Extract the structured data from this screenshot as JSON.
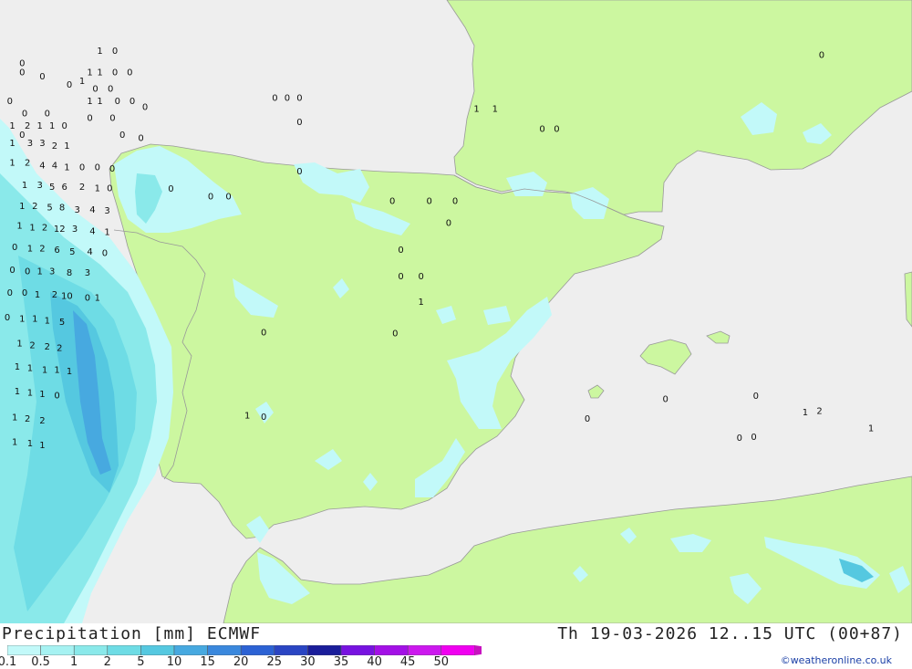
{
  "title": "Precipitation [mm] ECMWF",
  "datetime": "Th 19-03-2026 12..15 UTC (00+87)",
  "credit": "©weatheronline.co.uk",
  "colors": {
    "sea": "#eeeeee",
    "land": "#ccf7a0",
    "border": "#999999",
    "label": "#111111",
    "credit": "#1a3fa6"
  },
  "legend": {
    "ticks": [
      "0.1",
      "0.5",
      "1",
      "2",
      "5",
      "10",
      "15",
      "20",
      "25",
      "30",
      "35",
      "40",
      "45",
      "50"
    ],
    "colors": [
      "#c2f9f9",
      "#a6f2f2",
      "#8ae9ea",
      "#6edce5",
      "#55c8e0",
      "#47a9e0",
      "#3a88dd",
      "#2c62d4",
      "#2a45c3",
      "#1a1d9a",
      "#7712e0",
      "#a310e6",
      "#cc18ee",
      "#f000f0",
      "#c812c0"
    ]
  },
  "map_labels": [
    {
      "text": "0",
      "lon": -9.66,
      "lat": 43.82
    },
    {
      "text": "0",
      "lon": -9.17,
      "lat": 43.62
    },
    {
      "text": "0",
      "lon": -8.51,
      "lat": 43.49
    },
    {
      "text": "0",
      "lon": -7.88,
      "lat": 43.43
    },
    {
      "text": "0",
      "lon": -7.51,
      "lat": 43.43
    },
    {
      "text": "0",
      "lon": -6.67,
      "lat": 43.15
    },
    {
      "text": "0",
      "lon": -3.51,
      "lat": 43.29
    },
    {
      "text": "0",
      "lon": -3.21,
      "lat": 43.29
    },
    {
      "text": "0",
      "lon": -2.91,
      "lat": 43.29
    },
    {
      "text": "0",
      "lon": -2.91,
      "lat": 42.92
    },
    {
      "text": "0",
      "lon": -2.91,
      "lat": 42.16
    },
    {
      "text": "0",
      "lon": -6.77,
      "lat": 42.67
    },
    {
      "text": "0",
      "lon": -6.04,
      "lat": 41.89
    },
    {
      "text": "0",
      "lon": -5.07,
      "lat": 41.77
    },
    {
      "text": "0",
      "lon": -4.64,
      "lat": 41.77
    },
    {
      "text": "1",
      "lon": -7.77,
      "lat": 44.01
    },
    {
      "text": "0",
      "lon": -7.4,
      "lat": 44.01
    },
    {
      "text": "1",
      "lon": -8.01,
      "lat": 43.68
    },
    {
      "text": "1",
      "lon": -7.77,
      "lat": 43.68
    },
    {
      "text": "0",
      "lon": -7.4,
      "lat": 43.68
    },
    {
      "text": "0",
      "lon": -7.04,
      "lat": 43.68
    },
    {
      "text": "1",
      "lon": -8.2,
      "lat": 43.55
    },
    {
      "text": "1",
      "lon": -8.01,
      "lat": 43.24
    },
    {
      "text": "1",
      "lon": -7.77,
      "lat": 43.24
    },
    {
      "text": "0",
      "lon": -7.34,
      "lat": 43.24
    },
    {
      "text": "0",
      "lon": -6.98,
      "lat": 43.24
    },
    {
      "text": "0",
      "lon": -8.01,
      "lat": 42.98
    },
    {
      "text": "0",
      "lon": -7.46,
      "lat": 42.98
    },
    {
      "text": "0",
      "lon": -7.22,
      "lat": 42.72
    },
    {
      "text": "0",
      "lon": -9.66,
      "lat": 43.68
    },
    {
      "text": "0",
      "lon": -9.96,
      "lat": 43.24
    },
    {
      "text": "0",
      "lon": -9.05,
      "lat": 43.05
    },
    {
      "text": "0",
      "lon": -9.6,
      "lat": 43.05
    },
    {
      "text": "0",
      "lon": -9.66,
      "lat": 42.72
    },
    {
      "text": "1",
      "lon": -9.9,
      "lat": 42.86
    },
    {
      "text": "2",
      "lon": -9.53,
      "lat": 42.86
    },
    {
      "text": "1",
      "lon": -9.23,
      "lat": 42.86
    },
    {
      "text": "1",
      "lon": -8.93,
      "lat": 42.86
    },
    {
      "text": "0",
      "lon": -8.63,
      "lat": 42.86
    },
    {
      "text": "1",
      "lon": -9.9,
      "lat": 42.59
    },
    {
      "text": "3",
      "lon": -9.47,
      "lat": 42.59
    },
    {
      "text": "3",
      "lon": -9.17,
      "lat": 42.59
    },
    {
      "text": "2",
      "lon": -8.87,
      "lat": 42.55
    },
    {
      "text": "1",
      "lon": -8.57,
      "lat": 42.55
    },
    {
      "text": "1",
      "lon": -9.9,
      "lat": 42.29
    },
    {
      "text": "2",
      "lon": -9.53,
      "lat": 42.29
    },
    {
      "text": "4",
      "lon": -9.17,
      "lat": 42.25
    },
    {
      "text": "4",
      "lon": -8.87,
      "lat": 42.25
    },
    {
      "text": "1",
      "lon": -8.57,
      "lat": 42.22
    },
    {
      "text": "0",
      "lon": -8.2,
      "lat": 42.22
    },
    {
      "text": "0",
      "lon": -7.83,
      "lat": 42.22
    },
    {
      "text": "0",
      "lon": -7.47,
      "lat": 42.2
    },
    {
      "text": "1",
      "lon": -9.6,
      "lat": 41.95
    },
    {
      "text": "3",
      "lon": -9.23,
      "lat": 41.95
    },
    {
      "text": "5",
      "lon": -8.93,
      "lat": 41.92
    },
    {
      "text": "6",
      "lon": -8.63,
      "lat": 41.92
    },
    {
      "text": "2",
      "lon": -8.2,
      "lat": 41.92
    },
    {
      "text": "1",
      "lon": -7.83,
      "lat": 41.9
    },
    {
      "text": "0",
      "lon": -7.53,
      "lat": 41.9
    },
    {
      "text": "1",
      "lon": -9.66,
      "lat": 41.62
    },
    {
      "text": "2",
      "lon": -9.35,
      "lat": 41.62
    },
    {
      "text": "5",
      "lon": -8.99,
      "lat": 41.6
    },
    {
      "text": "8",
      "lon": -8.69,
      "lat": 41.6
    },
    {
      "text": "3",
      "lon": -8.32,
      "lat": 41.57
    },
    {
      "text": "4",
      "lon": -7.95,
      "lat": 41.57
    },
    {
      "text": "3",
      "lon": -7.59,
      "lat": 41.55
    },
    {
      "text": "1",
      "lon": -9.72,
      "lat": 41.32
    },
    {
      "text": "1",
      "lon": -9.41,
      "lat": 41.29
    },
    {
      "text": "2",
      "lon": -9.11,
      "lat": 41.29
    },
    {
      "text": "12",
      "lon": -8.75,
      "lat": 41.27
    },
    {
      "text": "3",
      "lon": -8.38,
      "lat": 41.27
    },
    {
      "text": "4",
      "lon": -7.95,
      "lat": 41.24
    },
    {
      "text": "1",
      "lon": -7.59,
      "lat": 41.22
    },
    {
      "text": "0",
      "lon": -9.84,
      "lat": 40.99
    },
    {
      "text": "1",
      "lon": -9.47,
      "lat": 40.97
    },
    {
      "text": "2",
      "lon": -9.17,
      "lat": 40.97
    },
    {
      "text": "6",
      "lon": -8.81,
      "lat": 40.95
    },
    {
      "text": "5",
      "lon": -8.44,
      "lat": 40.92
    },
    {
      "text": "4",
      "lon": -8.01,
      "lat": 40.92
    },
    {
      "text": "0",
      "lon": -7.65,
      "lat": 40.9
    },
    {
      "text": "0",
      "lon": -9.9,
      "lat": 40.64
    },
    {
      "text": "0",
      "lon": -9.53,
      "lat": 40.62
    },
    {
      "text": "1",
      "lon": -9.23,
      "lat": 40.62
    },
    {
      "text": "3",
      "lon": -8.93,
      "lat": 40.62
    },
    {
      "text": "8",
      "lon": -8.51,
      "lat": 40.6
    },
    {
      "text": "3",
      "lon": -8.07,
      "lat": 40.6
    },
    {
      "text": "0",
      "lon": -9.96,
      "lat": 40.29
    },
    {
      "text": "0",
      "lon": -9.6,
      "lat": 40.29
    },
    {
      "text": "1",
      "lon": -9.29,
      "lat": 40.26
    },
    {
      "text": "2",
      "lon": -8.87,
      "lat": 40.26
    },
    {
      "text": "10",
      "lon": -8.57,
      "lat": 40.24
    },
    {
      "text": "0",
      "lon": -8.07,
      "lat": 40.21
    },
    {
      "text": "1",
      "lon": -7.83,
      "lat": 40.21
    },
    {
      "text": "0",
      "lon": -10.02,
      "lat": 39.91
    },
    {
      "text": "1",
      "lon": -9.66,
      "lat": 39.89
    },
    {
      "text": "1",
      "lon": -9.35,
      "lat": 39.89
    },
    {
      "text": "1",
      "lon": -9.05,
      "lat": 39.86
    },
    {
      "text": "5",
      "lon": -8.69,
      "lat": 39.84
    },
    {
      "text": "1",
      "lon": -9.72,
      "lat": 39.51
    },
    {
      "text": "2",
      "lon": -9.41,
      "lat": 39.48
    },
    {
      "text": "2",
      "lon": -9.05,
      "lat": 39.46
    },
    {
      "text": "2",
      "lon": -8.75,
      "lat": 39.44
    },
    {
      "text": "1",
      "lon": -9.78,
      "lat": 39.15
    },
    {
      "text": "1",
      "lon": -9.47,
      "lat": 39.13
    },
    {
      "text": "1",
      "lon": -9.11,
      "lat": 39.1
    },
    {
      "text": "1",
      "lon": -8.81,
      "lat": 39.1
    },
    {
      "text": "1",
      "lon": -8.51,
      "lat": 39.08
    },
    {
      "text": "1",
      "lon": -9.78,
      "lat": 38.77
    },
    {
      "text": "1",
      "lon": -9.47,
      "lat": 38.75
    },
    {
      "text": "1",
      "lon": -9.17,
      "lat": 38.73
    },
    {
      "text": "0",
      "lon": -8.81,
      "lat": 38.71
    },
    {
      "text": "1",
      "lon": -9.84,
      "lat": 38.37
    },
    {
      "text": "2",
      "lon": -9.53,
      "lat": 38.35
    },
    {
      "text": "2",
      "lon": -9.17,
      "lat": 38.32
    },
    {
      "text": "1",
      "lon": -9.84,
      "lat": 37.99
    },
    {
      "text": "1",
      "lon": -9.47,
      "lat": 37.97
    },
    {
      "text": "1",
      "lon": -9.17,
      "lat": 37.94
    },
    {
      "text": "0",
      "lon": -0.65,
      "lat": 41.7
    },
    {
      "text": "0",
      "lon": 0.25,
      "lat": 41.7
    },
    {
      "text": "0",
      "lon": 0.88,
      "lat": 41.7
    },
    {
      "text": "0",
      "lon": 0.72,
      "lat": 41.36
    },
    {
      "text": "0",
      "lon": -0.44,
      "lat": 40.95
    },
    {
      "text": "0",
      "lon": -0.44,
      "lat": 40.54
    },
    {
      "text": "0",
      "lon": 0.05,
      "lat": 40.54
    },
    {
      "text": "1",
      "lon": 0.05,
      "lat": 40.15
    },
    {
      "text": "0",
      "lon": -3.78,
      "lat": 39.68
    },
    {
      "text": "0",
      "lon": -0.58,
      "lat": 39.66
    },
    {
      "text": "1",
      "lon": 1.4,
      "lat": 43.12
    },
    {
      "text": "1",
      "lon": 1.85,
      "lat": 43.12
    },
    {
      "text": "0",
      "lon": 3.0,
      "lat": 42.81
    },
    {
      "text": "0",
      "lon": 3.35,
      "lat": 42.81
    },
    {
      "text": "0",
      "lon": 9.8,
      "lat": 43.95
    },
    {
      "text": "0",
      "lon": 6.0,
      "lat": 38.65
    },
    {
      "text": "0",
      "lon": 8.2,
      "lat": 38.7
    },
    {
      "text": "1",
      "lon": 9.4,
      "lat": 38.45
    },
    {
      "text": "2",
      "lon": 9.75,
      "lat": 38.47
    },
    {
      "text": "1",
      "lon": 11.0,
      "lat": 38.2
    },
    {
      "text": "0",
      "lon": 4.1,
      "lat": 38.35
    },
    {
      "text": "0",
      "lon": 7.8,
      "lat": 38.05
    },
    {
      "text": "0",
      "lon": 8.15,
      "lat": 38.07
    },
    {
      "text": "1",
      "lon": -4.18,
      "lat": 38.4
    },
    {
      "text": "0",
      "lon": -3.78,
      "lat": 38.38
    }
  ]
}
